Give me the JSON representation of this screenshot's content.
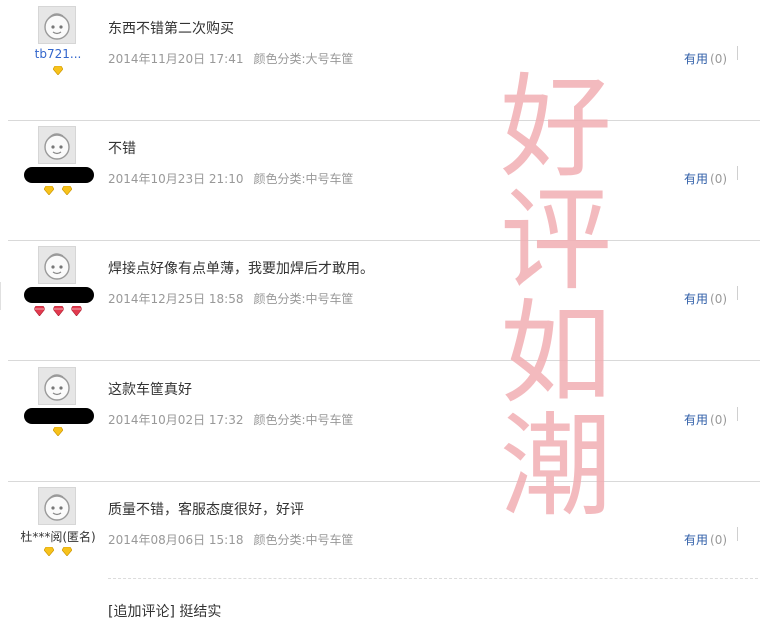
{
  "reviews": [
    {
      "user": "tb721...",
      "user_visible": true,
      "anonymous": false,
      "level_icons": [
        "gold-diamond"
      ],
      "text": "东西不错第二次购买",
      "date": "2014年11月20日 17:41",
      "sku": "颜色分类:大号车筐",
      "useful_label": "有用",
      "useful_count": "(0)"
    },
    {
      "user_visible": false,
      "level_icons": [
        "gold-diamond",
        "gold-diamond"
      ],
      "text": "不错",
      "date": "2014年10月23日 21:10",
      "sku": "颜色分类:中号车筐",
      "useful_label": "有用",
      "useful_count": "(0)"
    },
    {
      "user_visible": false,
      "level_icons": [
        "red-diamond",
        "red-diamond",
        "red-diamond"
      ],
      "text": "焊接点好像有点单薄，我要加焊后才敢用。",
      "date": "2014年12月25日 18:58",
      "sku": "颜色分类:中号车筐",
      "useful_label": "有用",
      "useful_count": "(0)"
    },
    {
      "user_visible": false,
      "level_icons": [
        "gold-diamond"
      ],
      "text": "这款车筐真好",
      "date": "2014年10月02日 17:32",
      "sku": "颜色分类:中号车筐",
      "useful_label": "有用",
      "useful_count": "(0)"
    },
    {
      "user": "杜***阅(匿名)",
      "user_visible": true,
      "anonymous": true,
      "level_icons": [
        "gold-diamond",
        "gold-diamond"
      ],
      "text": "质量不错，客服态度很好，好评",
      "date": "2014年08月06日 15:18",
      "sku": "颜色分类:中号车筐",
      "useful_label": "有用",
      "useful_count": "(0)",
      "append": "[追加评论] 挺结实"
    }
  ],
  "watermark": [
    "好",
    "评",
    "如",
    "潮"
  ],
  "colors": {
    "link": "#2f5ea8",
    "username": "#3366cc",
    "meta": "#999999",
    "watermark": "#f2aeb3",
    "gold_diamond": "#f7c21b",
    "red_diamond": "#e23a4e"
  }
}
